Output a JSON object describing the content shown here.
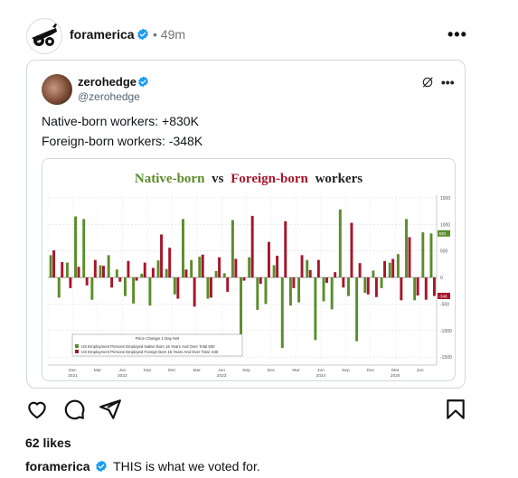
{
  "post": {
    "username": "foramerica",
    "time": "49m",
    "separator": "•",
    "more_label": "•••"
  },
  "embed": {
    "name": "zerohedge",
    "handle": "@zerohedge",
    "line1": "Native-born workers: +830K",
    "line2": "Foreign-born workers: -348K"
  },
  "chart_data": {
    "type": "bar",
    "title_part1": "Native-born",
    "title_vs": "vs",
    "title_part2": "Foreign-born",
    "title_part3": "workers",
    "legend_title": "Price Change 1 Day Net",
    "legend_native": "US Employment Persons Employed Native Born 16 Years And Over Total   830",
    "legend_foreign": "US Employment Persons Employed Foreign Born 16 Years And Over Total  -348",
    "last_native_label": "830",
    "last_foreign_label": "-348",
    "ylim": [
      -1650,
      1550
    ],
    "yticks": [
      "1500",
      "1000",
      "500",
      "0",
      "-500",
      "-1000",
      "-1500"
    ],
    "ytick_values": [
      1500,
      1000,
      500,
      0,
      -500,
      -1000,
      -1500
    ],
    "xticks": [
      {
        "month": "Dec",
        "year": "2021",
        "idx": 3
      },
      {
        "month": "Mar",
        "year": "",
        "idx": 6
      },
      {
        "month": "Jun",
        "year": "2022",
        "idx": 9
      },
      {
        "month": "Sep",
        "year": "",
        "idx": 12
      },
      {
        "month": "Dec",
        "year": "",
        "idx": 15
      },
      {
        "month": "Mar",
        "year": "",
        "idx": 18
      },
      {
        "month": "Jun",
        "year": "2023",
        "idx": 21
      },
      {
        "month": "Sep",
        "year": "",
        "idx": 24
      },
      {
        "month": "Dec",
        "year": "",
        "idx": 27
      },
      {
        "month": "Mar",
        "year": "",
        "idx": 30
      },
      {
        "month": "Jun",
        "year": "2024",
        "idx": 33
      },
      {
        "month": "Sep",
        "year": "",
        "idx": 36
      },
      {
        "month": "Dec",
        "year": "",
        "idx": 39
      },
      {
        "month": "Mar",
        "year": "2025",
        "idx": 42
      },
      {
        "month": "Jun",
        "year": "",
        "idx": 45
      }
    ],
    "series": [
      {
        "name": "US Employment Persons Employed Native Born 16 Years And Over Total",
        "color": "#5b8c2a",
        "values": [
          420,
          -380,
          280,
          1150,
          1100,
          -420,
          230,
          420,
          150,
          -350,
          -490,
          70,
          -530,
          320,
          160,
          -320,
          1100,
          330,
          390,
          -400,
          120,
          80,
          1080,
          -1200,
          380,
          -610,
          -500,
          230,
          -1330,
          -530,
          -470,
          330,
          -1180,
          -450,
          -600,
          1280,
          -350,
          -1200,
          -290,
          130,
          -200,
          280,
          440,
          1100,
          -430,
          850,
          830
        ]
      },
      {
        "name": "US Employment Persons Employed Foreign Born 16 Years And Over Total",
        "color": "#a5162a",
        "values": [
          510,
          290,
          -200,
          200,
          -150,
          330,
          220,
          -190,
          -80,
          310,
          -60,
          280,
          180,
          810,
          560,
          -400,
          150,
          -550,
          430,
          -380,
          380,
          -270,
          350,
          -60,
          1160,
          -120,
          670,
          410,
          1060,
          -200,
          420,
          140,
          330,
          -100,
          100,
          -190,
          1030,
          270,
          -320,
          -370,
          310,
          350,
          -430,
          760,
          -340,
          -420,
          -348
        ]
      }
    ]
  },
  "likes": "62 likes",
  "caption": {
    "username": "foramerica",
    "text": "THIS is what we voted for."
  },
  "colors": {
    "verified": "#1d9bf0",
    "native": "#5b8c2a",
    "foreign": "#a5162a"
  }
}
